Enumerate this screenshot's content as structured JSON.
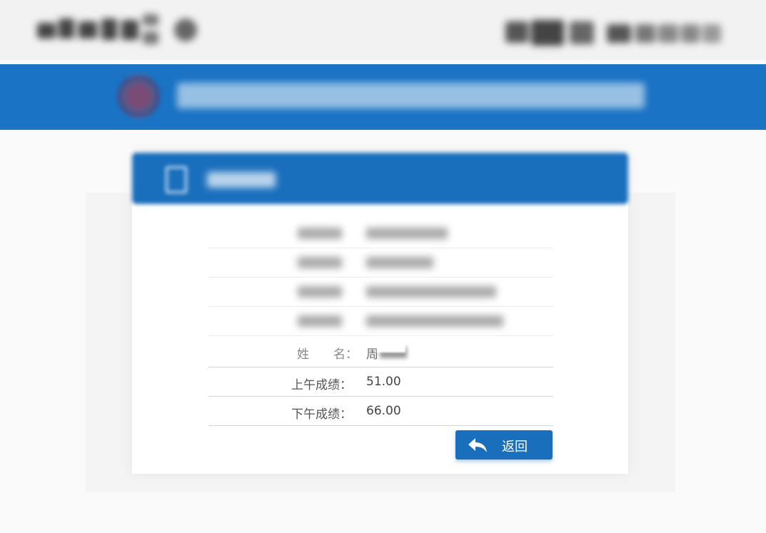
{
  "header": {
    "logo_icon": "logo-icon",
    "brand_text": "",
    "right_text": ""
  },
  "banner": {
    "title": "",
    "emblem_icon": "emblem-icon"
  },
  "panel": {
    "title": "",
    "title_icon": "document-icon"
  },
  "rows": {
    "r1": {
      "label": "",
      "value": ""
    },
    "r2": {
      "label": "",
      "value": ""
    },
    "r3": {
      "label": "",
      "value": ""
    },
    "r4": {
      "label": "",
      "value": ""
    },
    "name": {
      "label": "姓　　名：",
      "value": "周"
    },
    "morning": {
      "label": "上午成绩：",
      "value": "51.00"
    },
    "afternoon": {
      "label": "下午成绩：",
      "value": "66.00"
    }
  },
  "actions": {
    "return_label": "返回",
    "return_icon": "reply-arrow-icon"
  },
  "colors": {
    "brand_blue": "#1a73c4",
    "button_blue": "#1a6fbd"
  }
}
